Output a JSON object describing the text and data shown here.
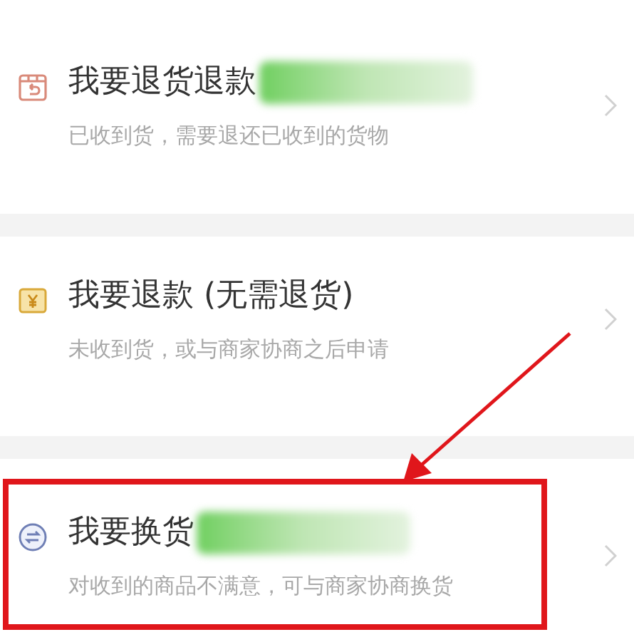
{
  "options": [
    {
      "kind": "return",
      "title": "我要退货退款",
      "subtitle": "已收到货，需要退还已收到的货物",
      "redacted": true,
      "highlighted": false
    },
    {
      "kind": "refund",
      "title": "我要退款 (无需退货)",
      "subtitle": "未收到货，或与商家协商之后申请",
      "redacted": false,
      "highlighted": false
    },
    {
      "kind": "exchange",
      "title": "我要换货",
      "subtitle": "对收到的商品不满意，可与商家协商换货",
      "redacted": true,
      "highlighted": true
    }
  ]
}
